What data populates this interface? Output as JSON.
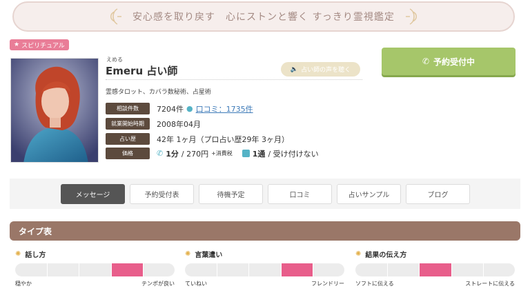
{
  "banner": {
    "text": "安心感を取り戻す　心にストンと響く すっきり霊視鑑定"
  },
  "badge": {
    "label": "スピリチュアル"
  },
  "profile": {
    "furigana": "えめる",
    "name": "Emeru 占い師",
    "voice_button": "占い師の声を聴く",
    "specialties": "霊感タロット、カバラ数秘術、占星術"
  },
  "reserve_button": {
    "label": "予約受付中"
  },
  "info": {
    "consult_count": {
      "label": "相談件数",
      "value": "7204件",
      "review": "口コミ：1735件"
    },
    "start_date": {
      "label": "就業開始時期",
      "value": "2008年04月"
    },
    "career": {
      "label": "占い歴",
      "value": "42年 1ヶ月（プロ占い歴29年 3ヶ月）"
    },
    "price": {
      "label": "価格",
      "phone_unit": "1分",
      "phone_price": " / 270円",
      "tax": "+消費税",
      "mail_unit": "1通",
      "mail_price": " / 受け付けない"
    }
  },
  "tabs": [
    "メッセージ",
    "予約受付表",
    "待機予定",
    "口コミ",
    "占いサンプル",
    "ブログ"
  ],
  "type_table": {
    "title": "タイプ表",
    "gauges": [
      {
        "title": "話し方",
        "left": "穏やか",
        "right": "テンポが良い",
        "level_segment": 4,
        "segments": 5
      },
      {
        "title": "言葉遣い",
        "left": "ていねい",
        "right": "フレンドリー",
        "level_segment": 4,
        "segments": 5
      },
      {
        "title": "結果の伝え方",
        "left": "ソフトに伝える",
        "right": "ストレートに伝える",
        "level_segment": 3,
        "segments": 5
      }
    ]
  },
  "colors": {
    "accent_pink": "#e85e8b",
    "reserve_green": "#a6c66a",
    "label_brown": "#5c4a3d",
    "header_brown": "#9a7768"
  }
}
